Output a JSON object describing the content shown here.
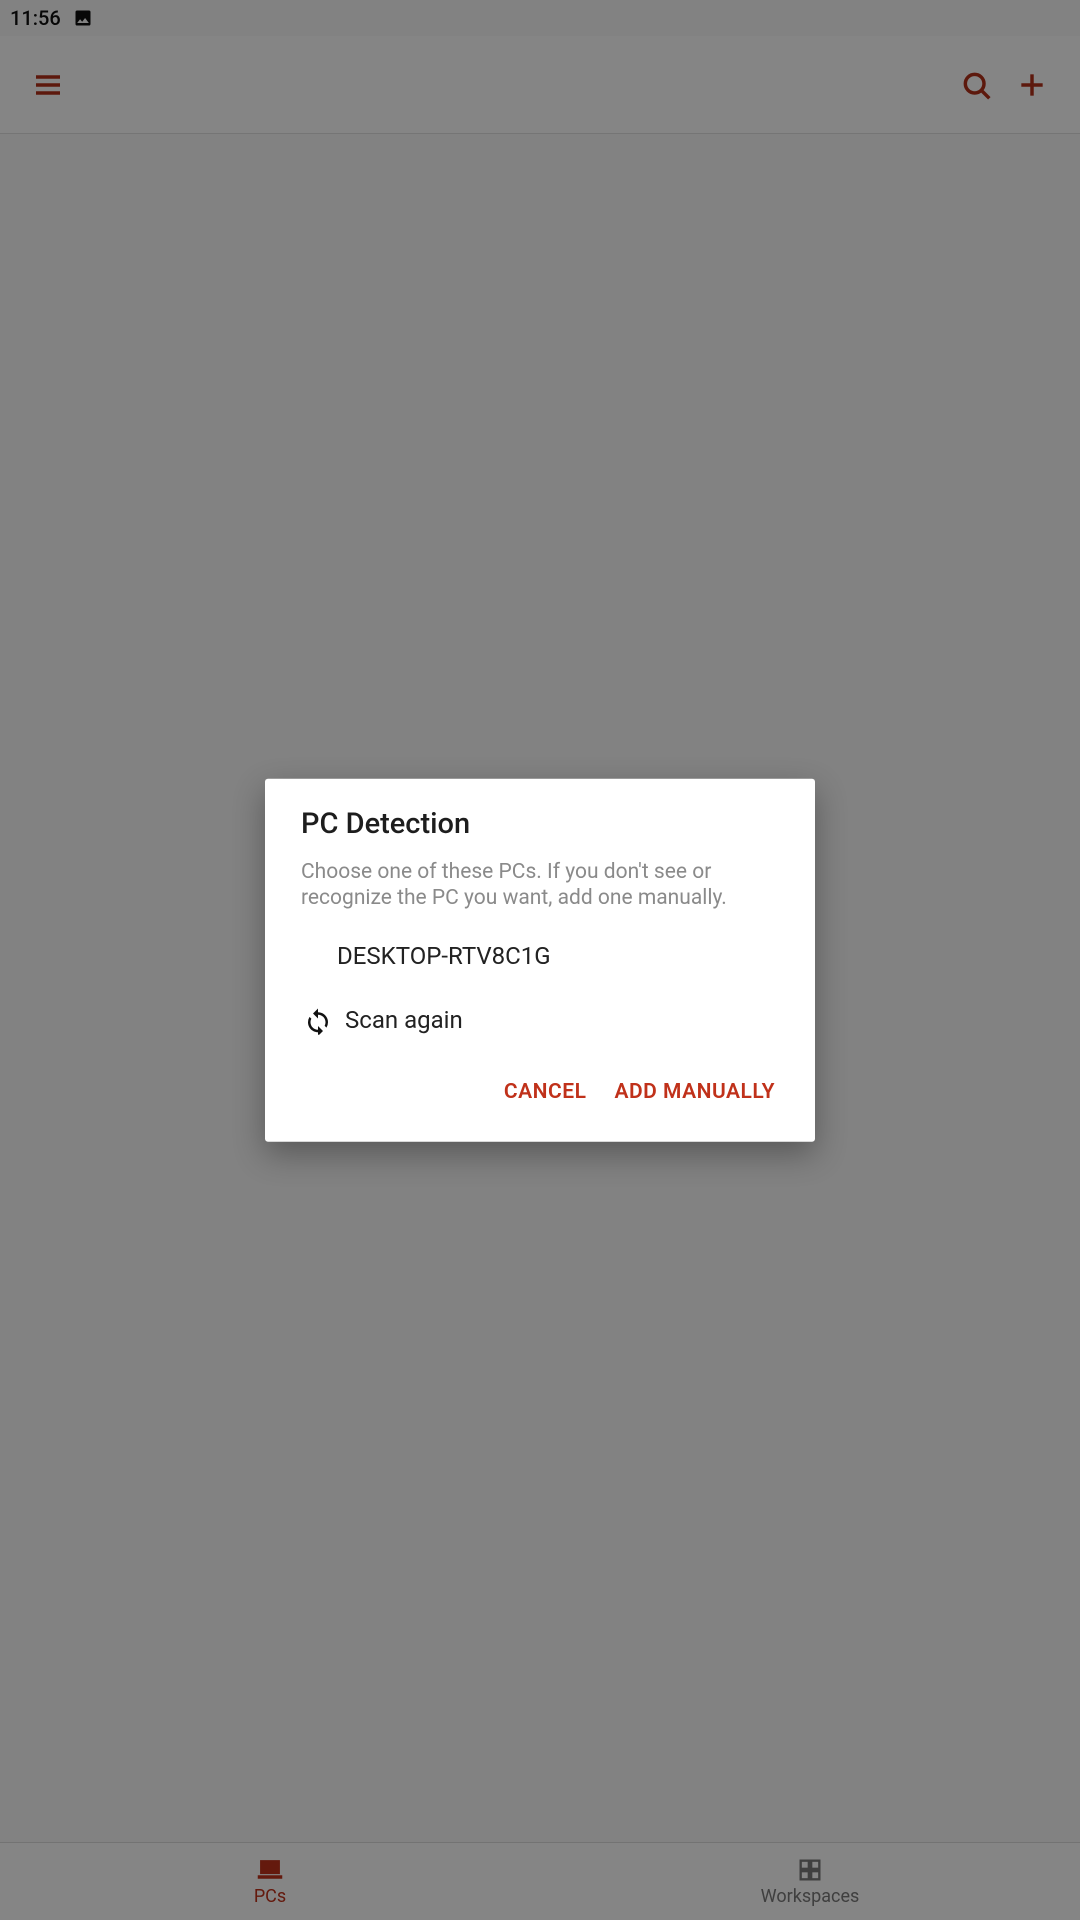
{
  "accent_color": "#c0311a",
  "status_bar": {
    "time": "11:56",
    "image_icon": "image-icon"
  },
  "app_bar": {
    "menu_icon": "hamburger-icon",
    "search_icon": "search-icon",
    "add_icon": "plus-icon"
  },
  "dialog": {
    "title": "PC Detection",
    "subtitle": "Choose one of these PCs. If you don't see or recognize the PC you want, add one manually.",
    "pcs": [
      {
        "name": "DESKTOP-RTV8C1G"
      }
    ],
    "scan_again_label": "Scan again",
    "scan_again_icon": "refresh-icon",
    "cancel_label": "CANCEL",
    "add_manually_label": "ADD MANUALLY"
  },
  "bottom_nav": {
    "tabs": [
      {
        "label": "PCs",
        "icon": "desktop-icon",
        "active": true
      },
      {
        "label": "Workspaces",
        "icon": "grid-icon",
        "active": false
      }
    ]
  }
}
